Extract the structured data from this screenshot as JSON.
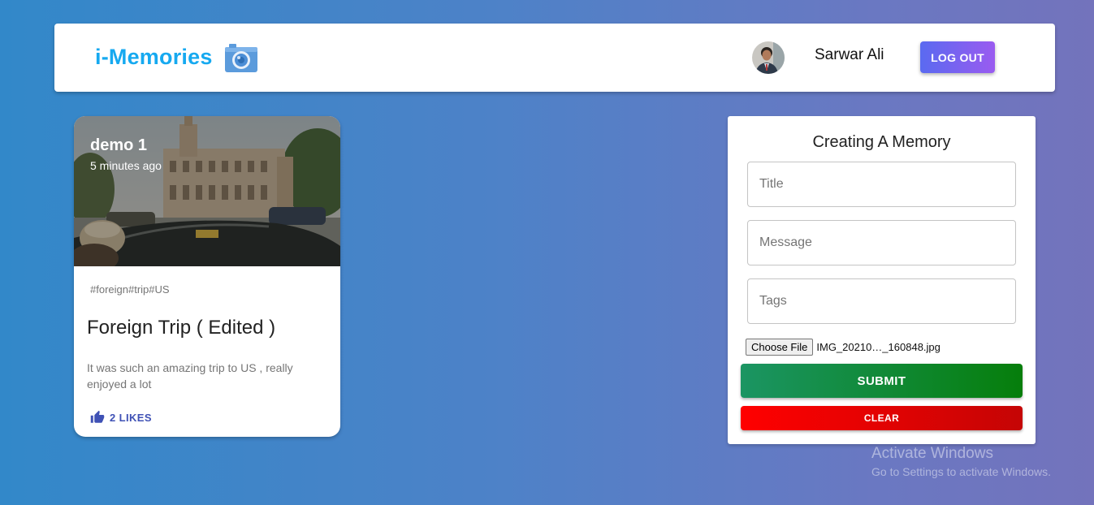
{
  "header": {
    "brand": "i-Memories",
    "brand_icon": "camera-icon",
    "user_name": "Sarwar Ali",
    "logout_label": "LOG OUT"
  },
  "posts": [
    {
      "creator": "demo 1",
      "time": "5 minutes ago",
      "tags": "#foreign#trip#US",
      "title": "Foreign Trip ( Edited )",
      "message": "It was such an amazing trip to US , really enjoyed a lot",
      "likes_label": "2 LIKES"
    }
  ],
  "form": {
    "title": "Creating A Memory",
    "title_placeholder": "Title",
    "message_placeholder": "Message",
    "tags_placeholder": "Tags",
    "file_button_label": "Choose File",
    "file_name": "IMG_20210…_160848.jpg",
    "submit_label": "SUBMIT",
    "clear_label": "CLEAR"
  },
  "watermark": {
    "title": "Activate Windows",
    "subtitle": "Go to Settings to activate Windows."
  },
  "colors": {
    "brand": "#16a9f0",
    "logout_gradient": [
      "#5a6af0",
      "#9a5bf0"
    ],
    "submit_gradient": [
      "#1b9563",
      "#067e0b"
    ],
    "clear_gradient": [
      "#ff0000",
      "#c50505"
    ],
    "like": "#3f51b5"
  }
}
